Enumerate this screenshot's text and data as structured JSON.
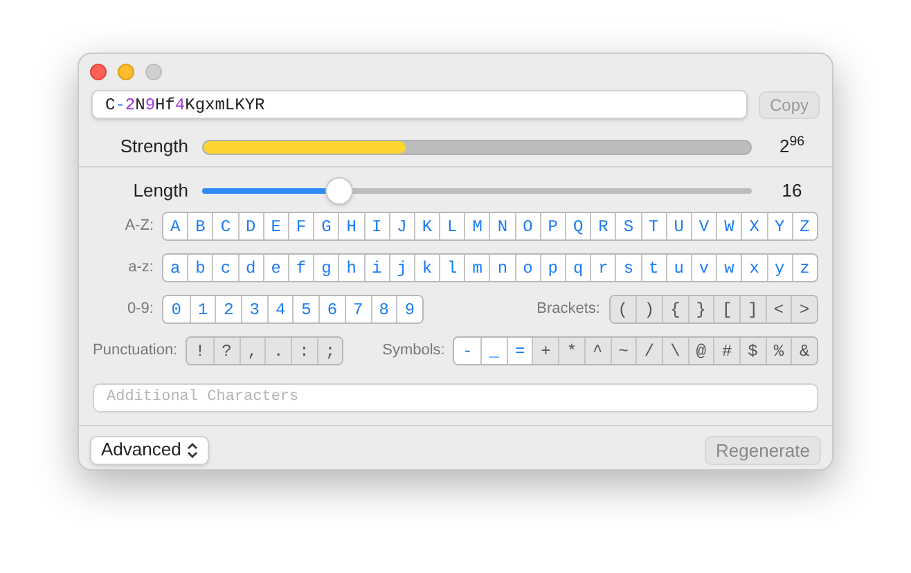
{
  "password": {
    "segments": [
      {
        "text": "C",
        "kind": "letter"
      },
      {
        "text": "-",
        "kind": "symbol"
      },
      {
        "text": "2",
        "kind": "digit"
      },
      {
        "text": "N",
        "kind": "letter"
      },
      {
        "text": "9",
        "kind": "digit"
      },
      {
        "text": "Hf",
        "kind": "letter"
      },
      {
        "text": "4",
        "kind": "digit"
      },
      {
        "text": "KgxmLKYR",
        "kind": "letter"
      }
    ]
  },
  "copy_button": "Copy",
  "strength": {
    "label": "Strength",
    "level": 0.37,
    "reading": "2$^{96}$"
  },
  "length": {
    "label": "Length",
    "level": 0.25,
    "reading": "16"
  },
  "rows": [
    [
      {
        "label": "A-Z:",
        "items": [
          {
            "char": "A",
            "selected": true
          },
          {
            "char": "B",
            "selected": true
          },
          {
            "char": "C",
            "selected": true
          },
          {
            "char": "D",
            "selected": true
          },
          {
            "char": "E",
            "selected": true
          },
          {
            "char": "F",
            "selected": true
          },
          {
            "char": "G",
            "selected": true
          },
          {
            "char": "H",
            "selected": true
          },
          {
            "char": "I",
            "selected": true
          },
          {
            "char": "J",
            "selected": true
          },
          {
            "char": "K",
            "selected": true
          },
          {
            "char": "L",
            "selected": true
          },
          {
            "char": "M",
            "selected": true
          },
          {
            "char": "N",
            "selected": true
          },
          {
            "char": "O",
            "selected": true
          },
          {
            "char": "P",
            "selected": true
          },
          {
            "char": "Q",
            "selected": true
          },
          {
            "char": "R",
            "selected": true
          },
          {
            "char": "S",
            "selected": true
          },
          {
            "char": "T",
            "selected": true
          },
          {
            "char": "U",
            "selected": true
          },
          {
            "char": "V",
            "selected": true
          },
          {
            "char": "W",
            "selected": true
          },
          {
            "char": "X",
            "selected": true
          },
          {
            "char": "Y",
            "selected": true
          },
          {
            "char": "Z",
            "selected": true
          }
        ]
      }
    ],
    [
      {
        "label": "a-z:",
        "items": [
          {
            "char": "a",
            "selected": true
          },
          {
            "char": "b",
            "selected": true
          },
          {
            "char": "c",
            "selected": true
          },
          {
            "char": "d",
            "selected": true
          },
          {
            "char": "e",
            "selected": true
          },
          {
            "char": "f",
            "selected": true
          },
          {
            "char": "g",
            "selected": true
          },
          {
            "char": "h",
            "selected": true
          },
          {
            "char": "i",
            "selected": true
          },
          {
            "char": "j",
            "selected": true
          },
          {
            "char": "k",
            "selected": true
          },
          {
            "char": "l",
            "selected": true
          },
          {
            "char": "m",
            "selected": true
          },
          {
            "char": "n",
            "selected": true
          },
          {
            "char": "o",
            "selected": true
          },
          {
            "char": "p",
            "selected": true
          },
          {
            "char": "q",
            "selected": true
          },
          {
            "char": "r",
            "selected": true
          },
          {
            "char": "s",
            "selected": true
          },
          {
            "char": "t",
            "selected": true
          },
          {
            "char": "u",
            "selected": true
          },
          {
            "char": "v",
            "selected": true
          },
          {
            "char": "w",
            "selected": true
          },
          {
            "char": "x",
            "selected": true
          },
          {
            "char": "y",
            "selected": true
          },
          {
            "char": "z",
            "selected": true
          }
        ]
      }
    ],
    [
      {
        "label": "0-9:",
        "items": [
          {
            "char": "0",
            "selected": true
          },
          {
            "char": "1",
            "selected": true
          },
          {
            "char": "2",
            "selected": true
          },
          {
            "char": "3",
            "selected": true
          },
          {
            "char": "4",
            "selected": true
          },
          {
            "char": "5",
            "selected": true
          },
          {
            "char": "6",
            "selected": true
          },
          {
            "char": "7",
            "selected": true
          },
          {
            "char": "8",
            "selected": true
          },
          {
            "char": "9",
            "selected": true
          }
        ]
      },
      {
        "label": "Brackets:",
        "items": [
          {
            "char": "(",
            "selected": false
          },
          {
            "char": ")",
            "selected": false
          },
          {
            "char": "{",
            "selected": false
          },
          {
            "char": "}",
            "selected": false
          },
          {
            "char": "[",
            "selected": false
          },
          {
            "char": "]",
            "selected": false
          },
          {
            "char": "<",
            "selected": false
          },
          {
            "char": ">",
            "selected": false
          }
        ]
      }
    ],
    [
      {
        "label": "Punctuation:",
        "items": [
          {
            "char": "!",
            "selected": false
          },
          {
            "char": "?",
            "selected": false
          },
          {
            "char": ",",
            "selected": false
          },
          {
            "char": ".",
            "selected": false
          },
          {
            "char": ":",
            "selected": false
          },
          {
            "char": ";",
            "selected": false
          }
        ]
      },
      {
        "label": "Symbols:",
        "items": [
          {
            "char": "-",
            "selected": true
          },
          {
            "char": "_",
            "selected": true
          },
          {
            "char": "=",
            "selected": true
          },
          {
            "char": "+",
            "selected": false
          },
          {
            "char": "*",
            "selected": false
          },
          {
            "char": "^",
            "selected": false
          },
          {
            "char": "~",
            "selected": false
          },
          {
            "char": "/",
            "selected": false
          },
          {
            "char": "\\",
            "selected": false
          },
          {
            "char": "@",
            "selected": false
          },
          {
            "char": "#",
            "selected": false
          },
          {
            "char": "$",
            "selected": false
          },
          {
            "char": "%",
            "selected": false
          },
          {
            "char": "&",
            "selected": false
          }
        ]
      }
    ]
  ],
  "additional": {
    "placeholder": "Additional Characters"
  },
  "mode_select": "Advanced",
  "regenerate_button": "Regenerate"
}
